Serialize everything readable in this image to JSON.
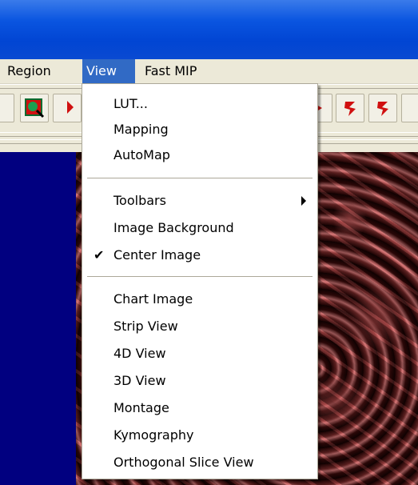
{
  "menubar": {
    "items": [
      {
        "label": "Region",
        "active": false
      },
      {
        "label": "View",
        "active": true
      },
      {
        "label": "Fast MIP",
        "active": false
      }
    ]
  },
  "colors": {
    "titlebar": "#0a55e0",
    "menu_highlight": "#316ac5",
    "background_panel": "#010080",
    "tool_icon": "#d01010"
  },
  "toolbar": {
    "icons": [
      "roi-zoom-icon",
      "red-arrow-icon",
      "red-arrow-icon",
      "red-shape-icon",
      "red-shape-icon"
    ]
  },
  "view_menu": {
    "groups": [
      [
        {
          "label": "LUT...",
          "checked": false,
          "submenu": false
        },
        {
          "label": "Mapping",
          "checked": false,
          "submenu": false
        },
        {
          "label": "AutoMap",
          "checked": false,
          "submenu": false
        }
      ],
      [
        {
          "label": "Toolbars",
          "checked": false,
          "submenu": true
        },
        {
          "label": "Image Background",
          "checked": false,
          "submenu": false
        },
        {
          "label": "Center Image",
          "checked": true,
          "submenu": false
        }
      ],
      [
        {
          "label": "Chart Image",
          "checked": false,
          "submenu": false
        },
        {
          "label": "Strip View",
          "checked": false,
          "submenu": false
        },
        {
          "label": "4D View",
          "checked": false,
          "submenu": false
        },
        {
          "label": "3D View",
          "checked": false,
          "submenu": false
        },
        {
          "label": "Montage",
          "checked": false,
          "submenu": false
        },
        {
          "label": "Kymography",
          "checked": false,
          "submenu": false
        },
        {
          "label": "Orthogonal Slice View",
          "checked": false,
          "submenu": false
        }
      ]
    ]
  }
}
